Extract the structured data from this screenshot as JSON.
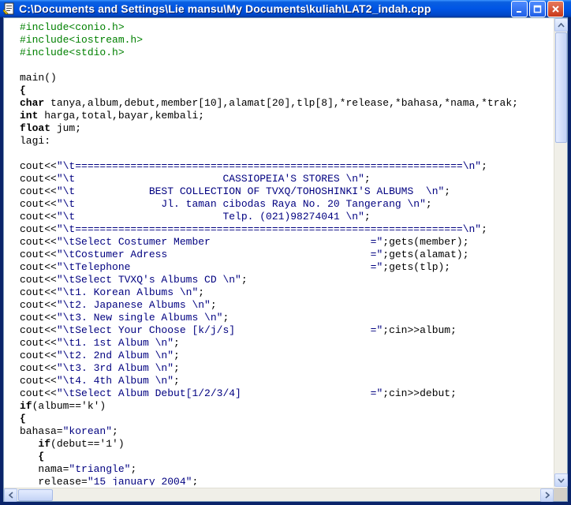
{
  "window": {
    "title": "C:\\Documents and Settings\\Lie mansu\\My Documents\\kuliah\\LAT2_indah.cpp",
    "icon": "cpp-file-icon",
    "controls": [
      "minimize",
      "maximize",
      "close"
    ]
  },
  "editor": {
    "lines": [
      {
        "t": "#include<conio.h>",
        "k": "pp"
      },
      {
        "t": "#include<iostream.h>",
        "k": "pp"
      },
      {
        "t": "#include<stdio.h>",
        "k": "pp"
      },
      {
        "t": "",
        "k": ""
      },
      {
        "t": "main()",
        "k": ""
      },
      {
        "t": "{",
        "k": "kw"
      },
      {
        "t": "char tanya,album,debut,member[10],alamat[20],tlp[8],*release,*bahasa,*nama,*trak;",
        "k": "kw1",
        "kwlen": 4
      },
      {
        "t": "int harga,total,bayar,kembali;",
        "k": "kw1",
        "kwlen": 3
      },
      {
        "t": "float jum;",
        "k": "kw1",
        "kwlen": 5
      },
      {
        "t": "lagi:",
        "k": ""
      },
      {
        "t": "",
        "k": ""
      },
      {
        "t": "cout<<\"\\t===============================================================\\n\";",
        "k": "str"
      },
      {
        "t": "cout<<\"\\t                        CASSIOPEIA'S STORES \\n\";",
        "k": "str"
      },
      {
        "t": "cout<<\"\\t            BEST COLLECTION OF TVXQ/TOHOSHINKI'S ALBUMS  \\n\";",
        "k": "str"
      },
      {
        "t": "cout<<\"\\t              Jl. taman cibodas Raya No. 20 Tangerang \\n\";",
        "k": "str"
      },
      {
        "t": "cout<<\"\\t                        Telp. (021)98274041 \\n\";",
        "k": "str"
      },
      {
        "t": "cout<<\"\\t===============================================================\\n\";",
        "k": "str"
      },
      {
        "t": "cout<<\"\\tSelect Costumer Member                          =\";gets(member);",
        "k": "str"
      },
      {
        "t": "cout<<\"\\tCostumer Adress                                 =\";gets(alamat);",
        "k": "str"
      },
      {
        "t": "cout<<\"\\tTelephone                                       =\";gets(tlp);",
        "k": "str"
      },
      {
        "t": "cout<<\"\\tSelect TVXQ's Albums CD \\n\";",
        "k": "str"
      },
      {
        "t": "cout<<\"\\t1. Korean Albums \\n\";",
        "k": "str"
      },
      {
        "t": "cout<<\"\\t2. Japanese Albums \\n\";",
        "k": "str"
      },
      {
        "t": "cout<<\"\\t3. New single Albums \\n\";",
        "k": "str"
      },
      {
        "t": "cout<<\"\\tSelect Your Choose [k/j/s]                      =\";cin>>album;",
        "k": "str"
      },
      {
        "t": "cout<<\"\\t1. 1st Album \\n\";",
        "k": "str"
      },
      {
        "t": "cout<<\"\\t2. 2nd Album \\n\";",
        "k": "str"
      },
      {
        "t": "cout<<\"\\t3. 3rd Album \\n\";",
        "k": "str"
      },
      {
        "t": "cout<<\"\\t4. 4th Album \\n\";",
        "k": "str"
      },
      {
        "t": "cout<<\"\\tSelect Album Debut[1/2/3/4]                     =\";cin>>debut;",
        "k": "str"
      },
      {
        "t": "if(album=='k')",
        "k": "kw1",
        "kwlen": 2
      },
      {
        "t": "{",
        "k": "kw"
      },
      {
        "t": "bahasa=\"korean\";",
        "k": "str"
      },
      {
        "t": "   if(debut=='1')",
        "k": "kwi",
        "kwstart": 3,
        "kwlen": 2
      },
      {
        "t": "   {",
        "k": "kw"
      },
      {
        "t": "   nama=\"triangle\";",
        "k": "str"
      },
      {
        "t": "   release=\"15 january 2004\";",
        "k": "str"
      }
    ]
  },
  "scrollbars": {
    "vertical": {
      "up": "scroll-up-arrow-icon",
      "down": "scroll-down-arrow-icon"
    },
    "horizontal": {
      "left": "scroll-left-arrow-icon",
      "right": "scroll-right-arrow-icon"
    }
  }
}
